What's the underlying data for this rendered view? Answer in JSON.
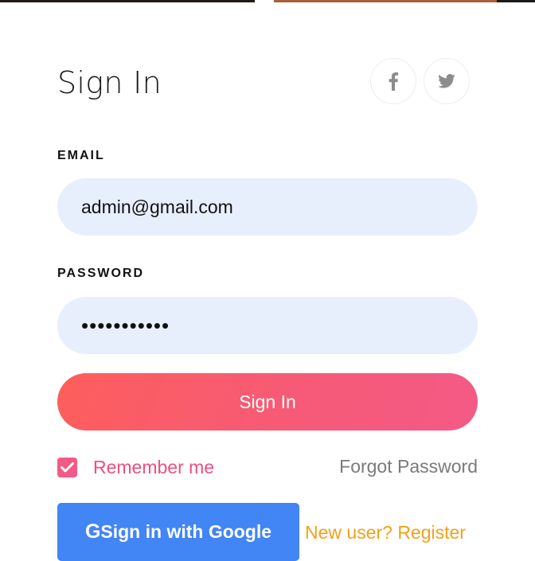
{
  "form": {
    "title": "Sign In",
    "social": [
      {
        "label": "f",
        "icon": "facebook-icon"
      },
      {
        "icon": "twitter-icon"
      }
    ],
    "email": {
      "label": "EMAIL",
      "value": "admin@gmail.com"
    },
    "password": {
      "label": "PASSWORD",
      "value": "•••••••••••"
    },
    "submit_label": "Sign In",
    "remember": {
      "label": "Remember me",
      "checked": true
    },
    "forgot_label": "Forgot Password",
    "google": {
      "icon_glyph": "G",
      "label": "Sign in with Google"
    },
    "register_label": "New user? Register"
  },
  "colors": {
    "input_bg": "#e8effc",
    "signin_gradient_start": "#fd5e5c",
    "signin_gradient_end": "#f35a86",
    "remember": "#ef4f7f",
    "forgot": "#7a7a7a",
    "google": "#4285f4",
    "register": "#f4a01a",
    "social_icon": "#8c8c8c"
  }
}
